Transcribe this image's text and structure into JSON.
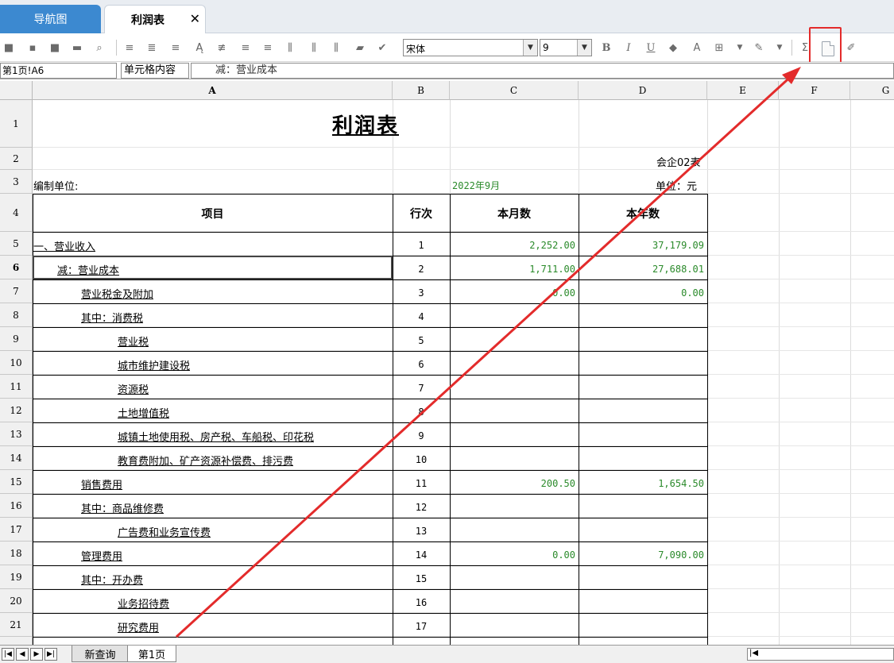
{
  "tabs": {
    "nav_label": "导航图",
    "active_label": "利润表",
    "close_glyph": "✕"
  },
  "toolbar": {
    "font_name": "宋体",
    "font_size": "9",
    "bold": "B",
    "italic": "I",
    "underline": "U"
  },
  "formula_bar": {
    "cell_ref": "第1页!A6",
    "label": "单元格内容",
    "content": "减：营业成本"
  },
  "columns": [
    "A",
    "B",
    "C",
    "D",
    "E",
    "F",
    "G"
  ],
  "rows": [
    "1",
    "2",
    "3",
    "4",
    "5",
    "6",
    "7",
    "8",
    "9",
    "10",
    "11",
    "12",
    "13",
    "14",
    "15",
    "16",
    "17",
    "18",
    "19",
    "20",
    "21",
    "22"
  ],
  "report": {
    "title": "利润表",
    "form_code": "会企02表",
    "company_label": "编制单位:",
    "period": "2022年9月",
    "unit": "单位：元",
    "headers": {
      "item": "项目",
      "line": "行次",
      "month": "本月数",
      "year": "本年数"
    },
    "lines": [
      {
        "item": "一、营业收入",
        "no": "1",
        "month": "2,252.00",
        "year": "37,179.09"
      },
      {
        "item": "减：营业成本",
        "no": "2",
        "month": "1,711.00",
        "year": "27,688.01"
      },
      {
        "item": "营业税金及附加",
        "no": "3",
        "month": "0.00",
        "year": "0.00"
      },
      {
        "item": "其中：消费税",
        "no": "4",
        "month": "",
        "year": ""
      },
      {
        "item": "营业税",
        "no": "5",
        "month": "",
        "year": ""
      },
      {
        "item": "城市维护建设税",
        "no": "6",
        "month": "",
        "year": ""
      },
      {
        "item": "资源税",
        "no": "7",
        "month": "",
        "year": ""
      },
      {
        "item": "土地增值税",
        "no": "8",
        "month": "",
        "year": ""
      },
      {
        "item": "城镇土地使用税、房产税、车船税、印花税",
        "no": "9",
        "month": "",
        "year": ""
      },
      {
        "item": "教育费附加、矿产资源补偿费、排污费",
        "no": "10",
        "month": "",
        "year": ""
      },
      {
        "item": "销售费用",
        "no": "11",
        "month": "200.50",
        "year": "1,654.50"
      },
      {
        "item": "其中：商品维修费",
        "no": "12",
        "month": "",
        "year": ""
      },
      {
        "item": "广告费和业务宣传费",
        "no": "13",
        "month": "",
        "year": ""
      },
      {
        "item": "管理费用",
        "no": "14",
        "month": "0.00",
        "year": "7,090.00"
      },
      {
        "item": "其中：开办费",
        "no": "15",
        "month": "",
        "year": ""
      },
      {
        "item": "业务招待费",
        "no": "16",
        "month": "",
        "year": ""
      },
      {
        "item": "研究费用",
        "no": "17",
        "month": "",
        "year": ""
      }
    ]
  },
  "sheets": {
    "first": "新查询",
    "second": "第1页"
  },
  "colors": {
    "accent_tab": "#3c89d0",
    "value_green": "#2a8a2a",
    "annotation_red": "#e32b2b"
  }
}
